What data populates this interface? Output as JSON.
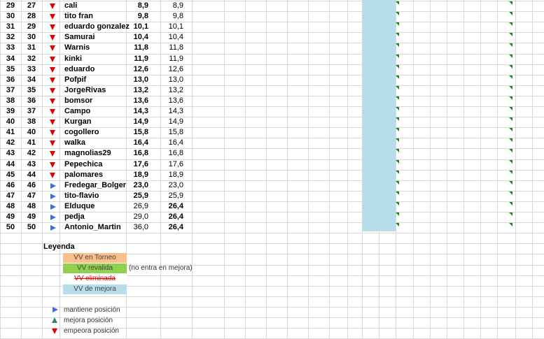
{
  "rows": [
    {
      "row": "29",
      "pos": "27",
      "trend": "down",
      "name": "cali",
      "v1": "8,9",
      "v2": "8,9",
      "v1_bold": true,
      "v2_bold": false
    },
    {
      "row": "30",
      "pos": "28",
      "trend": "down",
      "name": "tito fran",
      "v1": "9,8",
      "v2": "9,8",
      "v1_bold": true,
      "v2_bold": false
    },
    {
      "row": "31",
      "pos": "29",
      "trend": "down",
      "name": "eduardo gonzalez",
      "v1": "10,1",
      "v2": "10,1",
      "v1_bold": true,
      "v2_bold": false
    },
    {
      "row": "32",
      "pos": "30",
      "trend": "down",
      "name": "Samurai",
      "v1": "10,4",
      "v2": "10,4",
      "v1_bold": true,
      "v2_bold": false
    },
    {
      "row": "33",
      "pos": "31",
      "trend": "down",
      "name": "Warnis",
      "v1": "11,8",
      "v2": "11,8",
      "v1_bold": true,
      "v2_bold": false
    },
    {
      "row": "34",
      "pos": "32",
      "trend": "down",
      "name": "kinki",
      "v1": "11,9",
      "v2": "11,9",
      "v1_bold": true,
      "v2_bold": false
    },
    {
      "row": "35",
      "pos": "33",
      "trend": "down",
      "name": "eduardo",
      "v1": "12,6",
      "v2": "12,6",
      "v1_bold": true,
      "v2_bold": false
    },
    {
      "row": "36",
      "pos": "34",
      "trend": "down",
      "name": "Pofpif",
      "v1": "13,0",
      "v2": "13,0",
      "v1_bold": true,
      "v2_bold": false
    },
    {
      "row": "37",
      "pos": "35",
      "trend": "down",
      "name": "JorgeRivas",
      "v1": "13,2",
      "v2": "13,2",
      "v1_bold": true,
      "v2_bold": false
    },
    {
      "row": "38",
      "pos": "36",
      "trend": "down",
      "name": "bomsor",
      "v1": "13,6",
      "v2": "13,6",
      "v1_bold": true,
      "v2_bold": false
    },
    {
      "row": "39",
      "pos": "37",
      "trend": "down",
      "name": "Campo",
      "v1": "14,3",
      "v2": "14,3",
      "v1_bold": true,
      "v2_bold": false
    },
    {
      "row": "40",
      "pos": "38",
      "trend": "down",
      "name": "Kurgan",
      "v1": "14,9",
      "v2": "14,9",
      "v1_bold": true,
      "v2_bold": false
    },
    {
      "row": "41",
      "pos": "40",
      "trend": "down",
      "name": "cogollero",
      "v1": "15,8",
      "v2": "15,8",
      "v1_bold": true,
      "v2_bold": false
    },
    {
      "row": "42",
      "pos": "41",
      "trend": "down",
      "name": "walka",
      "v1": "16,4",
      "v2": "16,4",
      "v1_bold": true,
      "v2_bold": false
    },
    {
      "row": "43",
      "pos": "42",
      "trend": "down",
      "name": "magnolias29",
      "v1": "16,8",
      "v2": "16,8",
      "v1_bold": true,
      "v2_bold": false
    },
    {
      "row": "44",
      "pos": "43",
      "trend": "down",
      "name": "Pepechica",
      "v1": "17,6",
      "v2": "17,6",
      "v1_bold": true,
      "v2_bold": false
    },
    {
      "row": "45",
      "pos": "44",
      "trend": "down",
      "name": "palomares",
      "v1": "18,9",
      "v2": "18,9",
      "v1_bold": true,
      "v2_bold": false
    },
    {
      "row": "46",
      "pos": "46",
      "trend": "right",
      "name": "Fredegar_Bolger",
      "v1": "23,0",
      "v2": "23,0",
      "v1_bold": true,
      "v2_bold": false
    },
    {
      "row": "47",
      "pos": "47",
      "trend": "right",
      "name": "tito-flavio",
      "v1": "25,9",
      "v2": "25,9",
      "v1_bold": true,
      "v2_bold": false
    },
    {
      "row": "48",
      "pos": "48",
      "trend": "right",
      "name": "Elduque",
      "v1": "26,9",
      "v2": "26,4",
      "v1_bold": false,
      "v2_bold": true
    },
    {
      "row": "49",
      "pos": "49",
      "trend": "right",
      "name": "pedja",
      "v1": "29,0",
      "v2": "26,4",
      "v1_bold": false,
      "v2_bold": true
    },
    {
      "row": "50",
      "pos": "50",
      "trend": "right",
      "name": "Antonio_Martin",
      "v1": "36,0",
      "v2": "26,4",
      "v1_bold": false,
      "v2_bold": true
    }
  ],
  "legend": {
    "title": "Leyenda",
    "torneo": "VV en Torneo",
    "revalida": "VV revalida",
    "revalida_note": "(no entra en mejora)",
    "eliminada": "VV eliminada",
    "mejora": "VV de mejora",
    "mantiene": "mantiene posición",
    "mejora_pos": "mejora posición",
    "empeora": "empeora posición"
  },
  "colors": {
    "torneo": "#f9c08c",
    "revalida": "#8fd14f",
    "mejora": "#b7dde8",
    "down": "#e00000",
    "right": "#3a6fdc",
    "up": "#2e8b57"
  }
}
